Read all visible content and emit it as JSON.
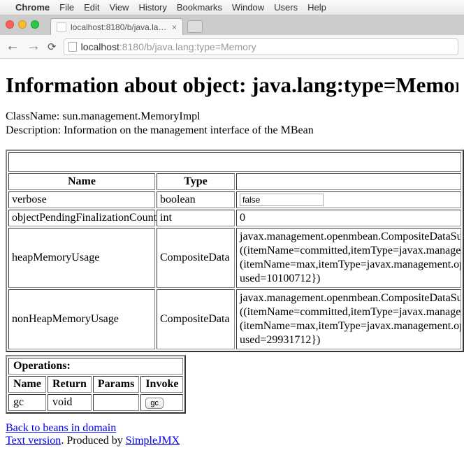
{
  "menubar": {
    "app": "Chrome",
    "items": [
      "File",
      "Edit",
      "View",
      "History",
      "Bookmarks",
      "Window",
      "Users",
      "Help"
    ]
  },
  "tab": {
    "title": "localhost:8180/b/java.lan…"
  },
  "url": {
    "host": "localhost",
    "rest": ":8180/b/java.lang:type=Memory"
  },
  "page": {
    "heading": "Information about object: java.lang:type=Memory",
    "class_label": "ClassName: ",
    "class_value": "sun.management.MemoryImpl",
    "desc_label": "Description: ",
    "desc_value": "Information on the management interface of the MBean"
  },
  "attr_table": {
    "headers": [
      "Name",
      "Type",
      ""
    ],
    "rows": [
      {
        "name": "verbose",
        "type": "boolean",
        "value": "false",
        "input": true
      },
      {
        "name": "objectPendingFinalizationCount",
        "type": "int",
        "value": "0",
        "input": false
      },
      {
        "name": "heapMemoryUsage",
        "type": "CompositeData",
        "value": "javax.management.openmbean.CompositeDataSupport((itemName=committed,itemType=javax.management.openmbean.SimpleType(name=java.lang.Long)),(itemName=init,itemType=javax.management.openmbean.SimpleType(name=java.lang.Long)),(itemName=max,itemType=javax.management.openmbean.SimpleType(name=java.lang.Long)),(itemName=used,itemType=javax.management.openmbean.SimpleType(name=java.lang.Long)))(contents={committed=..., init=..., max=..., used=10100712})",
        "input": false,
        "multiline": true
      },
      {
        "name": "nonHeapMemoryUsage",
        "type": "CompositeData",
        "value": "javax.management.openmbean.CompositeDataSupport((itemName=committed,itemType=javax.management.openmbean.SimpleType(name=java.lang.Long)),(itemName=init,itemType=javax.management.openmbean.SimpleType(name=java.lang.Long)),(itemName=max,itemType=javax.management.openmbean.SimpleType(name=java.lang.Long)),(itemName=used,itemType=javax.management.openmbean.SimpleType(name=java.lang.Long)))(contents={committed=..., init=..., max=..., used=29931712})",
        "input": false,
        "multiline": true
      }
    ],
    "display_lines": {
      "2": [
        "javax.management.openmbean.CompositeDataSupp",
        "((itemName=committed,itemType=javax.managemen",
        "(itemName=max,itemType=javax.management.open",
        "used=10100712})"
      ],
      "3": [
        "javax.management.openmbean.CompositeDataSupp",
        "((itemName=committed,itemType=javax.managemen",
        "(itemName=max,itemType=javax.management.open",
        "used=29931712})"
      ]
    }
  },
  "ops_table": {
    "caption": "Operations:",
    "headers": [
      "Name",
      "Return",
      "Params",
      "Invoke"
    ],
    "rows": [
      {
        "name": "gc",
        "ret": "void",
        "params": "",
        "invoke": "gc"
      }
    ]
  },
  "footer": {
    "back": "Back to beans in domain",
    "text_version": "Text version",
    "produced_by": ". Produced by ",
    "simplejmx": "SimpleJMX"
  }
}
